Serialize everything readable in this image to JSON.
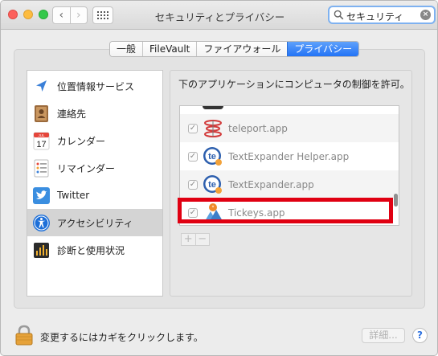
{
  "window": {
    "title": "セキュリティとプライバシー"
  },
  "toolbar": {
    "back_label": "‹",
    "forward_label": "›"
  },
  "search": {
    "value": "セキュリティ"
  },
  "tabs": [
    {
      "label": "一般",
      "active": false
    },
    {
      "label": "FileVault",
      "active": false
    },
    {
      "label": "ファイアウォール",
      "active": false
    },
    {
      "label": "プライバシー",
      "active": true
    }
  ],
  "sidebar": {
    "items": [
      {
        "label": "位置情報サービス",
        "icon": "location-arrow-icon",
        "selected": false
      },
      {
        "label": "連絡先",
        "icon": "contacts-book-icon",
        "selected": false
      },
      {
        "label": "カレンダー",
        "icon": "calendar-icon",
        "selected": false,
        "calendar_month": "JUL",
        "calendar_day": "17"
      },
      {
        "label": "リマインダー",
        "icon": "reminders-icon",
        "selected": false
      },
      {
        "label": "Twitter",
        "icon": "twitter-bird-icon",
        "selected": false
      },
      {
        "label": "アクセシビリティ",
        "icon": "accessibility-icon",
        "selected": true
      },
      {
        "label": "診断と使用状況",
        "icon": "diagnostics-icon",
        "selected": false
      }
    ]
  },
  "pane": {
    "caption": "下のアプリケーションにコンピュータの制御を許可。",
    "apps": [
      {
        "label": "teleport.app",
        "checked": true,
        "icon": "teleport-icon"
      },
      {
        "label": "TextExpander Helper.app",
        "checked": true,
        "icon": "textexpander-icon"
      },
      {
        "label": "TextExpander.app",
        "checked": true,
        "icon": "textexpander-icon"
      },
      {
        "label": "Tickeys.app",
        "checked": true,
        "icon": "tickeys-icon"
      }
    ],
    "add_label": "+",
    "remove_label": "−"
  },
  "footer": {
    "lock_text": "変更するにはカギをクリックします。",
    "detail_button": "詳細...",
    "help_button": "?"
  },
  "colors": {
    "accent": "#2273f6",
    "highlight_box": "#e00012"
  }
}
